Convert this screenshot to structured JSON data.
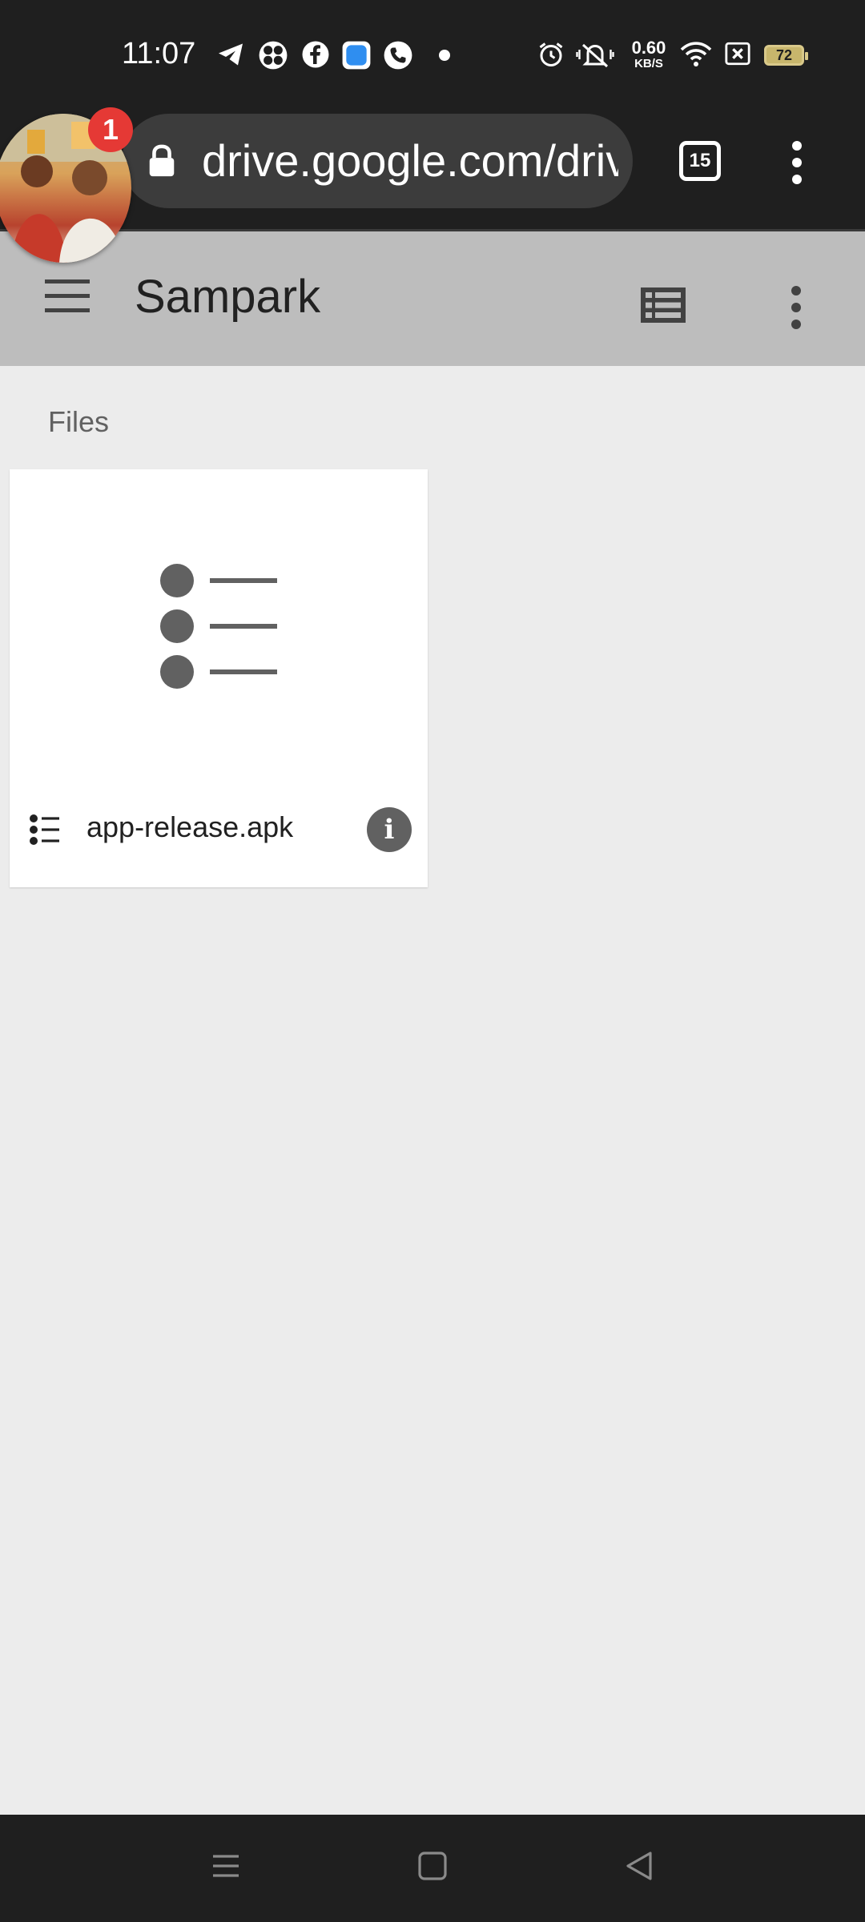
{
  "status_bar": {
    "time": "11:07",
    "net_speed_value": "0.60",
    "net_speed_unit": "KB/S",
    "battery_level": "72",
    "icons": [
      "telegram-icon",
      "pinwheel-icon",
      "facebook-icon",
      "messenger-icon",
      "phone-icon",
      "dot-icon",
      "alarm-icon",
      "vibrate-icon",
      "wifi-icon",
      "no-sim-icon",
      "battery-icon"
    ]
  },
  "browser": {
    "url": "drive.google.com/drive/folders",
    "tab_count": "15"
  },
  "chat_bubble": {
    "badge_count": "1"
  },
  "app_bar": {
    "title": "Sampark"
  },
  "content": {
    "section_label": "Files",
    "files": [
      {
        "name": "app-release.apk",
        "icon": "list-file-icon"
      }
    ]
  },
  "colors": {
    "status_bg": "#1f1f1f",
    "appbar_bg": "#bdbdbd",
    "page_bg": "#ececec",
    "badge": "#e53935"
  }
}
